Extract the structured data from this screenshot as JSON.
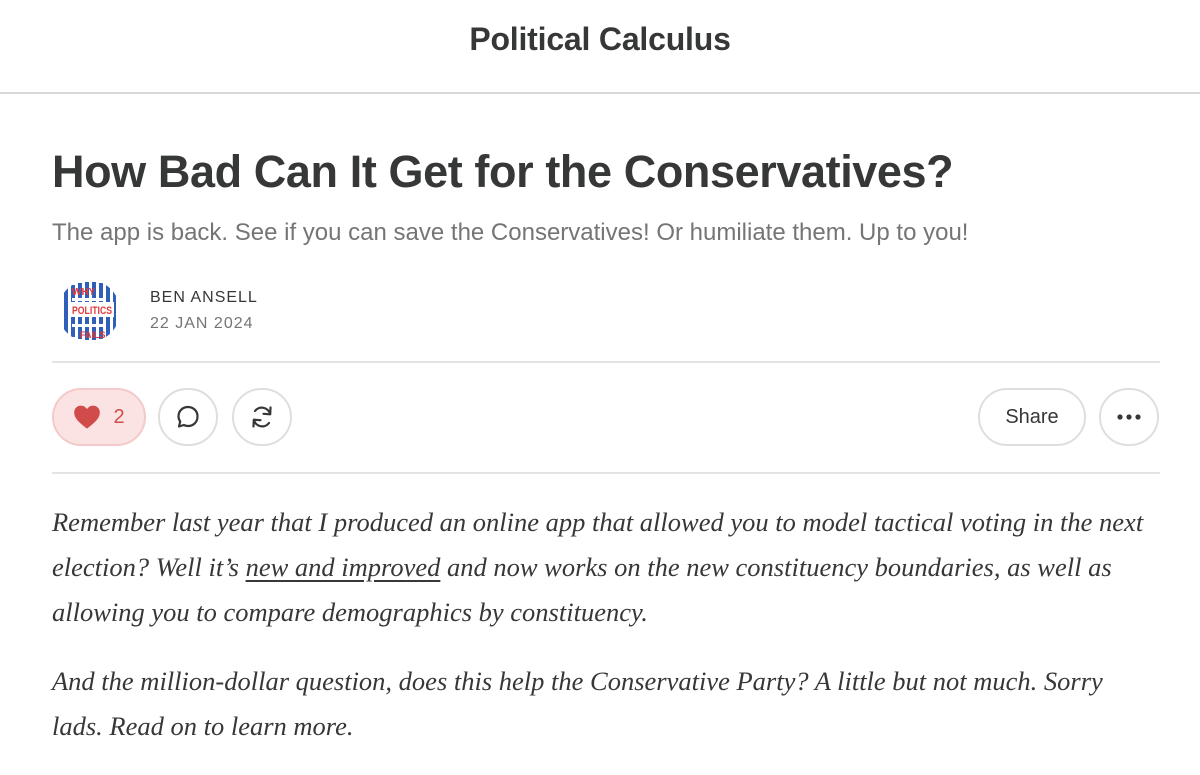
{
  "publication": {
    "name": "Political Calculus"
  },
  "post": {
    "title": "How Bad Can It Get for the Conservatives?",
    "subtitle": "The app is back. See if you can save the Conservatives! Or humiliate them. Up to you!",
    "author": "BEN ANSELL",
    "date": "22 JAN 2024",
    "avatar_logo_text": "WHY POLITICS FAILS"
  },
  "actions": {
    "like_count": "2",
    "share_label": "Share",
    "like_icon": "heart-icon",
    "comment_icon": "comment-icon",
    "restack_icon": "restack-icon",
    "more_icon": "more-icon"
  },
  "body": {
    "p1_before_link": "Remember last year that I produced an online app that allowed you to model tactical voting in the next election? Well it’s ",
    "p1_link": "new and improved",
    "p1_after_link": " and now works on the new constituency boundaries, as well as allowing you to compare demographics by constituency.",
    "p2": "And the million-dollar question, does this help the Conservative Party? A little but not much. Sorry lads. Read on to learn more."
  },
  "colors": {
    "text": "#363737",
    "muted": "#757575",
    "like_bg": "#fbe3e3",
    "like_accent": "#d24b4b",
    "logo_blue": "#2f5fb8",
    "logo_red": "#e03a3a"
  }
}
